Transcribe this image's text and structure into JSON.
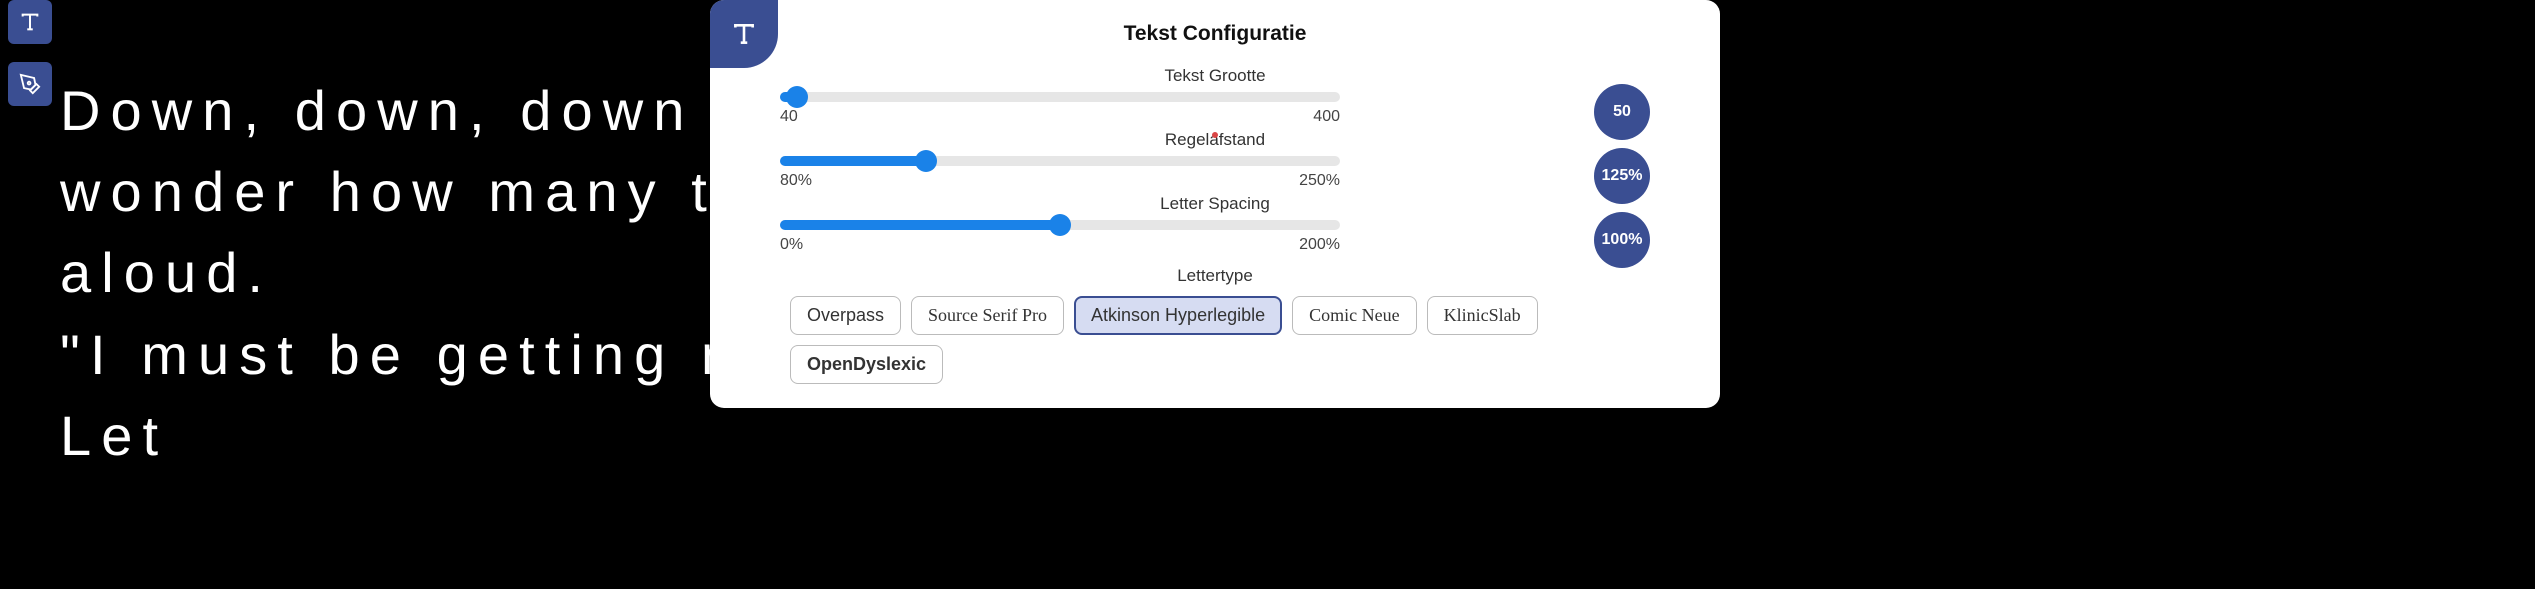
{
  "content_text": "Down, down, down                                  me to an end! \"I\nwonder how many                                   time?\" she said\naloud.\n\"I must be getting                                 ntre of the earth.\nLet",
  "toolbar": {
    "text_tool": "T",
    "pen_tool": "pen"
  },
  "panel": {
    "title": "Tekst Configuratie",
    "header_icon": "T",
    "controls": {
      "size": {
        "label": "Tekst Grootte",
        "min": "40",
        "max": "400",
        "value": "50",
        "fill_pct": 3
      },
      "line_height": {
        "label": "Regelafstand",
        "min": "80%",
        "max": "250%",
        "value": "125%",
        "fill_pct": 26
      },
      "letter_spacing": {
        "label": "Letter Spacing",
        "min": "0%",
        "max": "200%",
        "value": "100%",
        "fill_pct": 50
      }
    },
    "font_section": {
      "label": "Lettertype",
      "options": [
        {
          "name": "Overpass",
          "selected": false
        },
        {
          "name": "Source Serif Pro",
          "selected": false
        },
        {
          "name": "Atkinson Hyperlegible",
          "selected": true
        },
        {
          "name": "Comic Neue",
          "selected": false
        },
        {
          "name": "KlinicSlab",
          "selected": false
        },
        {
          "name": "OpenDyslexic",
          "selected": false
        }
      ]
    }
  }
}
